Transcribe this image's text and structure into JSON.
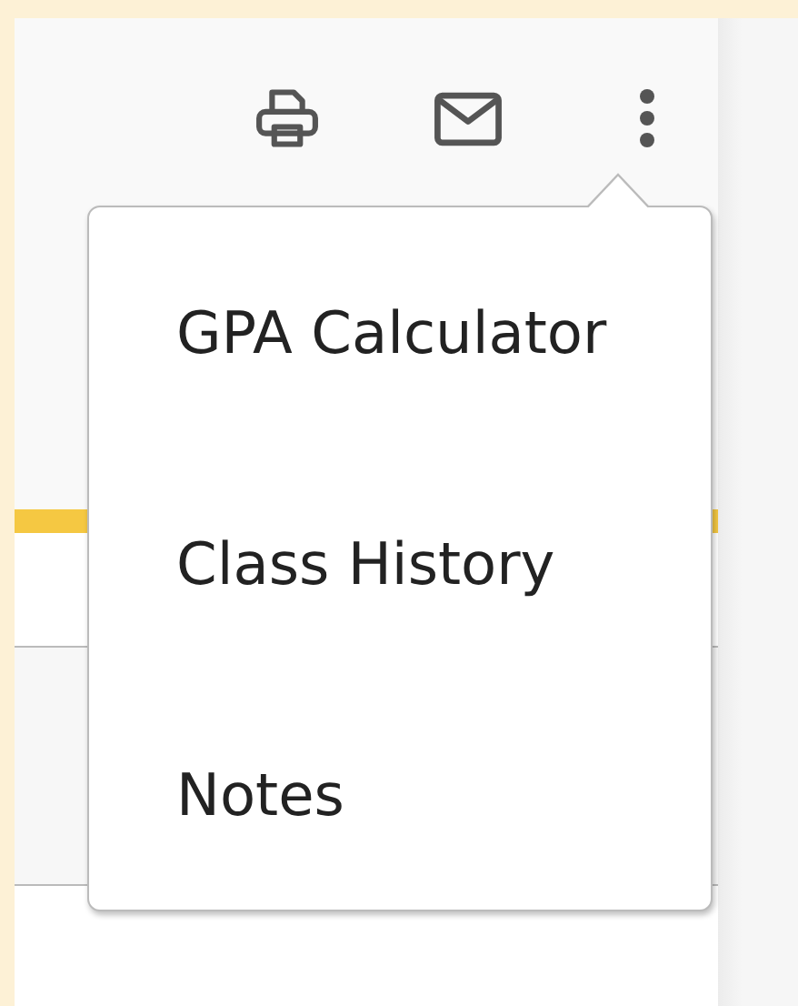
{
  "toolbar": {
    "actions": [
      {
        "kind": "print"
      },
      {
        "kind": "email"
      },
      {
        "kind": "more"
      }
    ]
  },
  "menu": {
    "items": [
      {
        "label": "GPA Calculator"
      },
      {
        "label": "Class History"
      },
      {
        "label": "Notes"
      }
    ]
  }
}
